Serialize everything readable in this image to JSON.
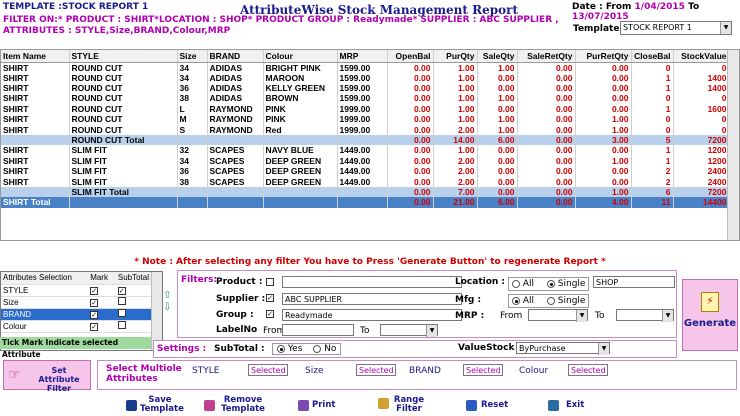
{
  "header": {
    "template_label": "TEMPLATE :STOCK REPORT 1",
    "title": "AttributeWise Stock Management Report",
    "date_from_label": "Date : From",
    "date_from": "1/04/2015",
    "date_to_label": "To",
    "date_to": "13/07/2015",
    "filter_line": "FILTER ON:* PRODUCT : SHIRT*LOCATION : SHOP* PRODUCT GROUP : Readymade* SUPPLIER : ABC SUPPLIER ,   ATTRIBUTES : STYLE,Size,BRAND,Colour,MRP",
    "template_select_label": "Template :",
    "template_select_value": "STOCK REPORT 1"
  },
  "grid": {
    "columns": [
      "Item Name",
      "STYLE",
      "Size",
      "BRAND",
      "Colour",
      "MRP",
      "OpenBal",
      "PurQty",
      "SaleQty",
      "SaleRetQty",
      "PurRetQty",
      "CloseBal",
      "StockValue"
    ],
    "rows": [
      {
        "type": "row",
        "cells": [
          "SHIRT",
          "ROUND CUT",
          "34",
          "ADIDAS",
          "BRIGHT PINK",
          "1599.00",
          "0.00",
          "1.00",
          "1.00",
          "0.00",
          "0.00",
          "0",
          "0"
        ]
      },
      {
        "type": "row",
        "cells": [
          "SHIRT",
          "ROUND CUT",
          "34",
          "ADIDAS",
          "MAROON",
          "1599.00",
          "0.00",
          "1.00",
          "0.00",
          "0.00",
          "0.00",
          "1",
          "1400"
        ]
      },
      {
        "type": "row",
        "cells": [
          "SHIRT",
          "ROUND CUT",
          "36",
          "ADIDAS",
          "KELLY GREEN",
          "1599.00",
          "0.00",
          "1.00",
          "0.00",
          "0.00",
          "0.00",
          "1",
          "1400"
        ]
      },
      {
        "type": "row",
        "cells": [
          "SHIRT",
          "ROUND CUT",
          "38",
          "ADIDAS",
          "BROWN",
          "1599.00",
          "0.00",
          "1.00",
          "1.00",
          "0.00",
          "0.00",
          "0",
          "0"
        ]
      },
      {
        "type": "row",
        "cells": [
          "SHIRT",
          "ROUND CUT",
          "L",
          "RAYMOND",
          "PINK",
          "1999.00",
          "0.00",
          "1.00",
          "0.00",
          "0.00",
          "0.00",
          "1",
          "1600"
        ]
      },
      {
        "type": "row",
        "cells": [
          "SHIRT",
          "ROUND CUT",
          "M",
          "RAYMOND",
          "PINK",
          "1999.00",
          "0.00",
          "1.00",
          "1.00",
          "0.00",
          "1.00",
          "0",
          "0"
        ]
      },
      {
        "type": "row",
        "cells": [
          "SHIRT",
          "ROUND CUT",
          "S",
          "RAYMOND",
          "Red",
          "1999.00",
          "0.00",
          "2.00",
          "1.00",
          "0.00",
          "1.00",
          "0",
          "0"
        ]
      },
      {
        "type": "total",
        "cells": [
          "",
          "ROUND CUT Total",
          "",
          "",
          "",
          "",
          "0.00",
          "14.00",
          "6.00",
          "0.00",
          "3.00",
          "5",
          "7200"
        ]
      },
      {
        "type": "row",
        "cells": [
          "SHIRT",
          "SLIM FIT",
          "32",
          "SCAPES",
          "NAVY BLUE",
          "1449.00",
          "0.00",
          "1.00",
          "0.00",
          "0.00",
          "0.00",
          "1",
          "1200"
        ]
      },
      {
        "type": "row",
        "cells": [
          "SHIRT",
          "SLIM FIT",
          "34",
          "SCAPES",
          "DEEP GREEN",
          "1449.00",
          "0.00",
          "2.00",
          "0.00",
          "0.00",
          "1.00",
          "1",
          "1200"
        ]
      },
      {
        "type": "row",
        "cells": [
          "SHIRT",
          "SLIM FIT",
          "36",
          "SCAPES",
          "DEEP GREEN",
          "1449.00",
          "0.00",
          "2.00",
          "0.00",
          "0.00",
          "0.00",
          "2",
          "2400"
        ]
      },
      {
        "type": "row",
        "cells": [
          "SHIRT",
          "SLIM FIT",
          "38",
          "SCAPES",
          "DEEP GREEN",
          "1449.00",
          "0.00",
          "2.00",
          "0.00",
          "0.00",
          "0.00",
          "2",
          "2400"
        ]
      },
      {
        "type": "total",
        "cells": [
          "",
          "SLIM FIT Total",
          "",
          "",
          "",
          "",
          "0.00",
          "7.00",
          "0.00",
          "0.00",
          "1.00",
          "6",
          "7200"
        ]
      },
      {
        "type": "grand",
        "cells": [
          "SHIRT Total",
          "",
          "",
          "",
          "",
          "",
          "0.00",
          "21.00",
          "6.00",
          "0.00",
          "4.00",
          "11",
          "14400"
        ]
      }
    ]
  },
  "note": "* Note  :  After selecting any filter You have to Press 'Generate Button' to regenerate Report  *",
  "attributes": {
    "headers": [
      "Attributes Selection",
      "Mark",
      "SubTotal"
    ],
    "items": [
      {
        "name": "STYLE",
        "mark": true,
        "subtotal": true
      },
      {
        "name": "Size",
        "mark": true,
        "subtotal": false
      },
      {
        "name": "BRAND",
        "mark": true,
        "subtotal": false
      },
      {
        "name": "Colour",
        "mark": true,
        "subtotal": false
      }
    ],
    "tick_hint": "Tick Mark Indicate selected Attribute"
  },
  "filters": {
    "label": "Filters:",
    "product_label": "Product :",
    "product_value": "",
    "supplier_label": "Supplier :",
    "supplier_value": "ABC SUPPLIER",
    "group_label": "Group :",
    "group_value": "Readymade",
    "labelno_label": "LabelNo",
    "from_label": "From",
    "to_label": "To",
    "location_label": "Location :",
    "location_all": "All",
    "location_single": "Single",
    "location_value": "SHOP",
    "mfg_label": "Mfg :",
    "mfg_all": "All",
    "mfg_single": "Single",
    "mrp_label": "MRP :",
    "mrp_from": "From",
    "mrp_to": "To"
  },
  "settings": {
    "label": "Settings :",
    "subtotal_label": "SubTotal :",
    "yes": "Yes",
    "no": "No",
    "valuestock_label": "ValueStock",
    "valuestock_value": "ByPurchase"
  },
  "generate_label": "Generate",
  "set_attribute_label": "Set Attribute Filter",
  "multi": {
    "label": "Select Multiole Attributes",
    "style_label": "STYLE",
    "size_label": "Size",
    "brand_label": "BRAND",
    "colour_label": "Colour",
    "selected": "Selected"
  },
  "toolbar": {
    "save": "Save Template",
    "remove": "Remove Template",
    "print": "Print",
    "range": "Range Filter",
    "reset": "Reset",
    "exit": "Exit"
  },
  "colors": {
    "accent": "#1a1a8c",
    "purple": "#b000b0",
    "total_row": "#b8d0ec",
    "grand_row": "#4a82c8",
    "generate_bg": "#f5c6ea"
  }
}
